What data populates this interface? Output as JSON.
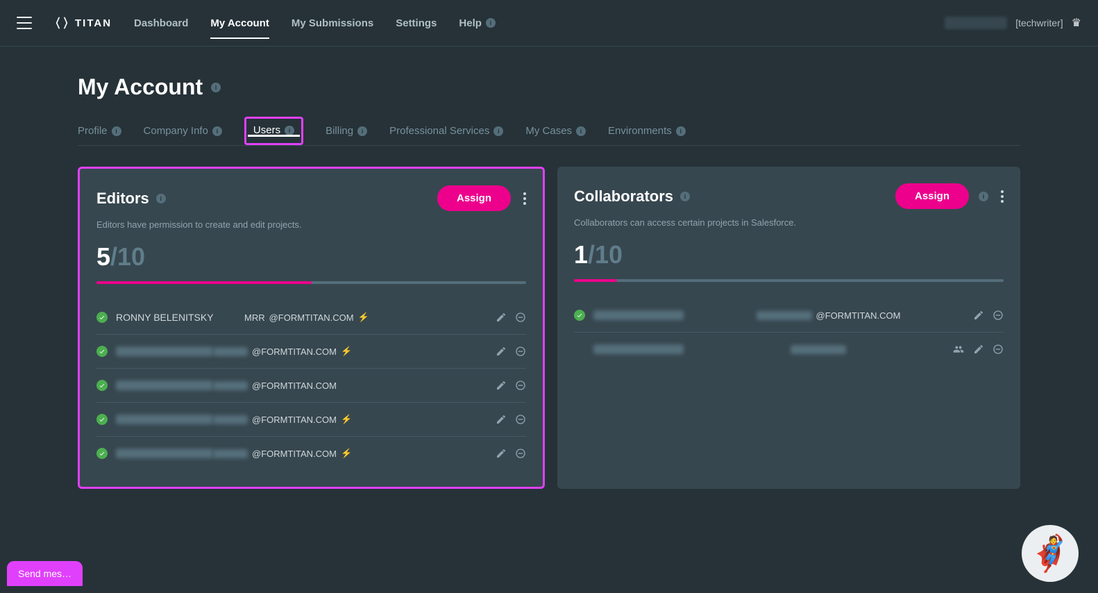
{
  "brand": "TITAN",
  "nav": {
    "items": [
      "Dashboard",
      "My Account",
      "My Submissions",
      "Settings",
      "Help"
    ],
    "active_index": 1,
    "role": "[techwriter]"
  },
  "page": {
    "title": "My Account",
    "tabs": [
      "Profile",
      "Company Info",
      "Users",
      "Billing",
      "Professional Services",
      "My Cases",
      "Environments"
    ],
    "active_tab_index": 2
  },
  "editors": {
    "title": "Editors",
    "description": "Editors have permission to create and edit projects.",
    "assign_label": "Assign",
    "used": "5",
    "total": "/10",
    "progress_pct": 50,
    "rows": [
      {
        "name": "RONNY BELENITSKY",
        "email_prefix": "MRR",
        "email_domain": "@FORMTITAN.COM",
        "bolt": true,
        "name_blurred": false
      },
      {
        "name": "",
        "email_prefix": "",
        "email_domain": "@FORMTITAN.COM",
        "bolt": true,
        "name_blurred": true
      },
      {
        "name": "",
        "email_prefix": "",
        "email_domain": "@FORMTITAN.COM",
        "bolt": false,
        "name_blurred": true
      },
      {
        "name": "",
        "email_prefix": "",
        "email_domain": "@FORMTITAN.COM",
        "bolt": true,
        "name_blurred": true
      },
      {
        "name": "",
        "email_prefix": "",
        "email_domain": "@FORMTITAN.COM",
        "bolt": true,
        "name_blurred": true
      }
    ]
  },
  "collaborators": {
    "title": "Collaborators",
    "description": "Collaborators can access certain projects in Salesforce.",
    "assign_label": "Assign",
    "used": "1",
    "total": "/10",
    "progress_pct": 10,
    "rows": [
      {
        "email_domain": "@FORMTITAN.COM",
        "checked": true,
        "people_icon": false
      },
      {
        "email_domain": "",
        "checked": false,
        "people_icon": true
      }
    ]
  },
  "footer": {
    "send_message": "Send mes…"
  }
}
